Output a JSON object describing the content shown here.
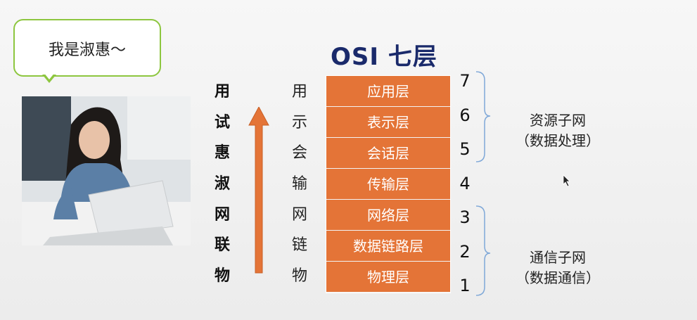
{
  "speech_bubble": {
    "text": "我是淑惠～"
  },
  "title": "OSI  七层",
  "mnemonic": [
    "用",
    "试",
    "惠",
    "淑",
    "网",
    "联",
    "物"
  ],
  "layer_initials": [
    "用",
    "示",
    "会",
    "输",
    "网",
    "链",
    "物"
  ],
  "layers": [
    {
      "number": "7",
      "name": "应用层"
    },
    {
      "number": "6",
      "name": "表示层"
    },
    {
      "number": "5",
      "name": "会话层"
    },
    {
      "number": "4",
      "name": "传输层"
    },
    {
      "number": "3",
      "name": "网络层"
    },
    {
      "number": "2",
      "name": "数据链路层"
    },
    {
      "number": "1",
      "name": "物理层"
    }
  ],
  "groups": [
    {
      "name": "资源子网",
      "sub": "（数据处理）"
    },
    {
      "name": "通信子网",
      "sub": "（数据通信）"
    }
  ],
  "colors": {
    "layer_fill": "#e47437",
    "title": "#1a2a6b",
    "bubble_border": "#8dc63f",
    "bracket": "#7fa8d8"
  }
}
